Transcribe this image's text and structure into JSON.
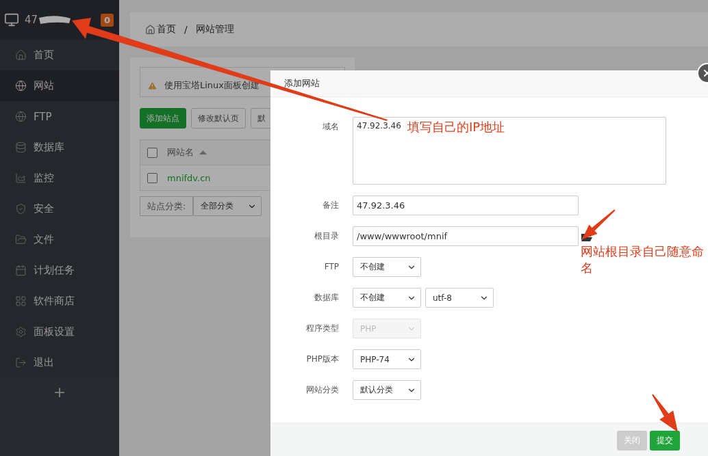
{
  "sidebar": {
    "host": "47",
    "badge": "0",
    "items": [
      {
        "label": "首页",
        "selected": false
      },
      {
        "label": "网站",
        "selected": true
      },
      {
        "label": "FTP",
        "selected": false
      },
      {
        "label": "数据库",
        "selected": false
      },
      {
        "label": "监控",
        "selected": false
      },
      {
        "label": "安全",
        "selected": false
      },
      {
        "label": "文件",
        "selected": false
      },
      {
        "label": "计划任务",
        "selected": false
      },
      {
        "label": "软件商店",
        "selected": false
      },
      {
        "label": "面板设置",
        "selected": false
      },
      {
        "label": "退出",
        "selected": false
      }
    ],
    "add": "+"
  },
  "breadcrumb": {
    "items": [
      "首页",
      "网站管理"
    ],
    "separator": "/"
  },
  "notice": "使用宝塔Linux面板创建",
  "toolbar": [
    {
      "label": "添加站点",
      "kind": "primary"
    },
    {
      "label": "修改默认页",
      "kind": "default"
    },
    {
      "label": "默",
      "kind": "default"
    }
  ],
  "table": {
    "header_checked": false,
    "columns": [
      "网站名"
    ],
    "rows": [
      {
        "checked": false,
        "name": "mnifdv.cn"
      }
    ]
  },
  "category": {
    "label": "站点分类:",
    "value": "全部分类"
  },
  "dialog": {
    "title": "添加网站",
    "fields": [
      {
        "kind": "textarea",
        "label": "域名",
        "value": "47.92.3.46"
      },
      {
        "kind": "input",
        "label": "备注",
        "value": "47.92.3.46"
      },
      {
        "kind": "path",
        "label": "根目录",
        "value": "/www/wwwroot/mnif"
      },
      {
        "kind": "select",
        "label": "FTP",
        "selects": [
          {
            "value": "不创建",
            "disabled": false
          }
        ]
      },
      {
        "kind": "select",
        "label": "数据库",
        "selects": [
          {
            "value": "不创建",
            "disabled": false
          },
          {
            "value": "utf-8",
            "disabled": false
          }
        ]
      },
      {
        "kind": "select",
        "label": "程序类型",
        "selects": [
          {
            "value": "PHP",
            "disabled": true
          }
        ]
      },
      {
        "kind": "select",
        "label": "PHP版本",
        "selects": [
          {
            "value": "PHP-74",
            "disabled": false
          }
        ]
      },
      {
        "kind": "select",
        "label": "网站分类",
        "selects": [
          {
            "value": "默认分类",
            "disabled": false
          }
        ]
      }
    ],
    "buttons": [
      {
        "label": "关闭",
        "kind": "secondary"
      },
      {
        "label": "提交",
        "kind": "primary"
      }
    ]
  },
  "annotations": [
    "填写自己的IP地址",
    "网站根目录自己随意命名"
  ]
}
